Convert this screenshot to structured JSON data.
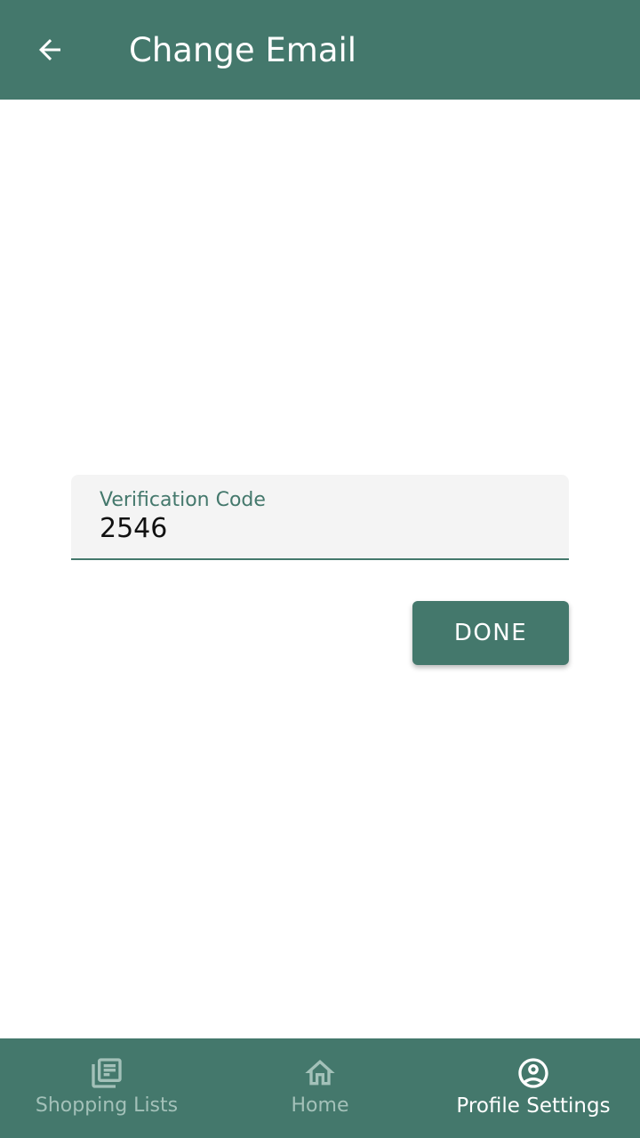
{
  "header": {
    "title": "Change Email",
    "back_icon": "arrow-left-icon"
  },
  "form": {
    "field_label": "Verification Code",
    "field_value": "2546",
    "done_label": "DONE"
  },
  "bottom_nav": {
    "items": [
      {
        "label": "Shopping Lists",
        "icon": "list-icon",
        "active": false
      },
      {
        "label": "Home",
        "icon": "home-icon",
        "active": false
      },
      {
        "label": "Profile Settings",
        "icon": "account-circle-icon",
        "active": true
      }
    ]
  },
  "colors": {
    "primary": "#44786c",
    "inactive_nav": "#a3c1b9",
    "field_background": "#f4f4f4"
  }
}
